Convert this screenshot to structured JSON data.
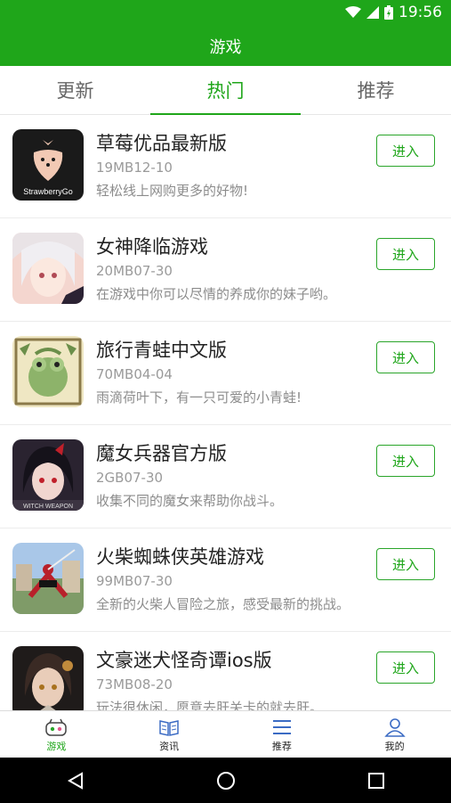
{
  "status": {
    "time": "19:56"
  },
  "header": {
    "title": "游戏"
  },
  "tabs": [
    {
      "label": "更新"
    },
    {
      "label": "热门"
    },
    {
      "label": "推荐"
    }
  ],
  "items": [
    {
      "title": "草莓优品最新版",
      "meta": "19MB12-10",
      "desc": "轻松线上网购更多的好物!",
      "button": "进入",
      "icon_text": "StrawberryGo"
    },
    {
      "title": "女神降临游戏",
      "meta": "20MB07-30",
      "desc": "在游戏中你可以尽情的养成你的妹子哟。",
      "button": "进入"
    },
    {
      "title": "旅行青蛙中文版",
      "meta": "70MB04-04",
      "desc": "雨滴荷叶下，有一只可爱的小青蛙!",
      "button": "进入"
    },
    {
      "title": "魔女兵器官方版",
      "meta": "2GB07-30",
      "desc": "收集不同的魔女来帮助你战斗。",
      "button": "进入",
      "icon_text": "WITCH WEAPON"
    },
    {
      "title": "火柴蜘蛛侠英雄游戏",
      "meta": "99MB07-30",
      "desc": "全新的火柴人冒险之旅，感受最新的挑战。",
      "button": "进入"
    },
    {
      "title": "文豪迷犬怪奇谭ios版",
      "meta": "73MB08-20",
      "desc": "玩法很休闲，愿意去肝关卡的就去肝。",
      "button": "进入"
    }
  ],
  "bottom_nav": [
    {
      "label": "游戏",
      "icon": "gamepad-icon"
    },
    {
      "label": "资讯",
      "icon": "book-icon"
    },
    {
      "label": "推荐",
      "icon": "menu-icon"
    },
    {
      "label": "我的",
      "icon": "user-icon"
    }
  ],
  "colors": {
    "primary": "#1fa61a",
    "text": "#222222",
    "muted": "#9a9a9a"
  }
}
